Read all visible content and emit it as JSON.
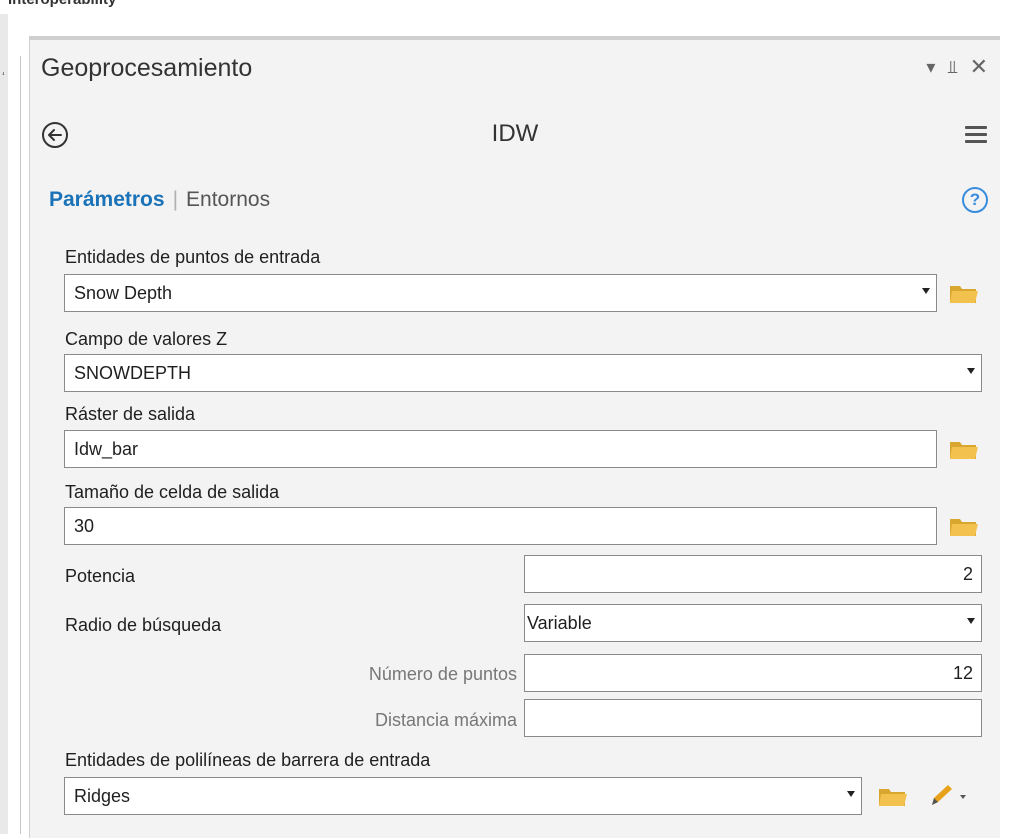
{
  "top_strip_text": "Interoperability",
  "pane": {
    "title": "Geoprocesamiento",
    "icons": [
      "dropdown-arrow-icon",
      "pin-icon",
      "close-icon"
    ]
  },
  "tool": {
    "name": "IDW",
    "back_icon": "back-arrow-icon",
    "menu_icon": "hamburger-menu-icon"
  },
  "tabs": {
    "params": "Parámetros",
    "envs": "Entornos",
    "help_glyph": "?"
  },
  "params": {
    "input_points": {
      "label": "Entidades de puntos de entrada",
      "value": "Snow Depth"
    },
    "z_field": {
      "label": "Campo de valores Z",
      "value": "SNOWDEPTH"
    },
    "output_raster": {
      "label": "Ráster de salida",
      "value": "Idw_bar"
    },
    "cell_size": {
      "label": "Tamaño de celda de salida",
      "value": "30"
    },
    "power": {
      "label": "Potencia",
      "value": "2"
    },
    "search_radius": {
      "label": "Radio de búsqueda",
      "value": "Variable"
    },
    "num_points": {
      "label": "Número de puntos",
      "value": "12"
    },
    "max_distance": {
      "label": "Distancia máxima",
      "value": ""
    },
    "barriers": {
      "label": "Entidades de polilíneas de barrera de entrada",
      "value": "Ridges"
    }
  },
  "colors": {
    "accent": "#1a73b8",
    "folder": "#f2c14e",
    "pencil": "#e8a21a",
    "panel_bg": "#f3f3f3"
  }
}
